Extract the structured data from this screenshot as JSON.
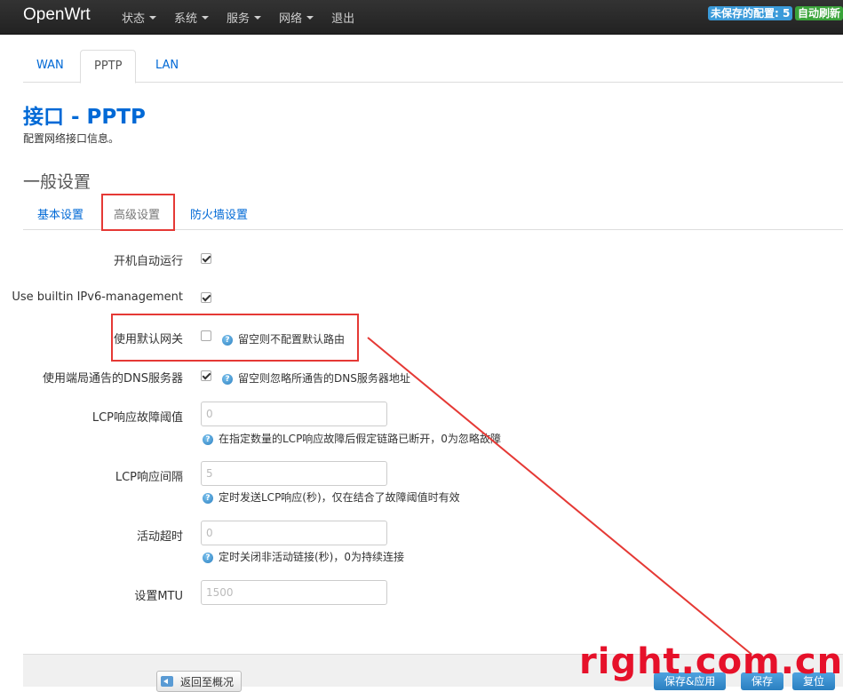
{
  "navbar": {
    "brand": "OpenWrt",
    "menu": [
      "状态",
      "系统",
      "服务",
      "网络",
      "退出"
    ],
    "unsaved_badge": "未保存的配置: 5",
    "refresh_badge": "自动刷新"
  },
  "tabs": [
    "WAN",
    "PPTP",
    "LAN"
  ],
  "page": {
    "title": "接口 - PPTP",
    "description": "配置网络接口信息。",
    "section_title": "一般设置"
  },
  "subtabs": [
    "基本设置",
    "高级设置",
    "防火墙设置"
  ],
  "fields": {
    "autostart": {
      "label": "开机自动运行",
      "checked": true
    },
    "ipv6": {
      "label": "Use builtin IPv6-management",
      "checked": true
    },
    "default_gw": {
      "label": "使用默认网关",
      "checked": false,
      "help": "留空则不配置默认路由"
    },
    "peer_dns": {
      "label": "使用端局通告的DNS服务器",
      "checked": true,
      "help": "留空则忽略所通告的DNS服务器地址"
    },
    "lcp_failure": {
      "label": "LCP响应故障阈值",
      "placeholder": "0",
      "help": "在指定数量的LCP响应故障后假定链路已断开，0为忽略故障"
    },
    "lcp_interval": {
      "label": "LCP响应间隔",
      "placeholder": "5",
      "help": "定时发送LCP响应(秒)，仅在结合了故障阈值时有效"
    },
    "idle_timeout": {
      "label": "活动超时",
      "placeholder": "0",
      "help": "定时关闭非活动链接(秒)，0为持续连接"
    },
    "mtu": {
      "label": "设置MTU",
      "placeholder": "1500"
    }
  },
  "footer": {
    "back": "返回至概况",
    "save_apply": "保存&应用",
    "save": "保存",
    "reset": "复位"
  },
  "watermark": "right.com.cn",
  "colors": {
    "accent": "#0069d6",
    "annotation": "#e53935"
  }
}
